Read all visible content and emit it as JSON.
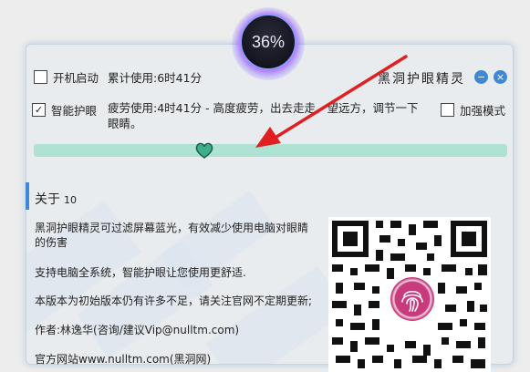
{
  "badge": {
    "percent": "36%"
  },
  "options": {
    "startup_label": "开机启动",
    "eye_protect_label": "智能护眼",
    "enhanced_label": "加强模式"
  },
  "stats": {
    "total_usage": "累计使用:6时41分",
    "fatigue": "疲劳使用:4时41分 - 高度疲劳，出去走走，望远方，调节一下眼睛。"
  },
  "window": {
    "title": "黑洞护眼精灵",
    "minimize_glyph": "−",
    "close_glyph": "×"
  },
  "slider": {
    "level_percent": 36
  },
  "about": {
    "heading": "关于",
    "version": "10",
    "lines": [
      "黑洞护眼精灵可过滤屏幕蓝光，有效减少使用电脑对眼睛的伤害",
      "支持电脑全系统，智能护眼让您使用更舒适.",
      "本版本为初始版本仍有许多不足，请关注官网不定期更新;",
      "作者:林逸华(咨询/建议Vip@nulltm.com)",
      "官方网站www.nulltm.com(黑洞网)"
    ]
  },
  "colors": {
    "accent": "#3d89d8",
    "slider": "#aee3d4",
    "thumb": "#3fae8c",
    "arrow": "#e02020",
    "glow": "#9b3cff"
  }
}
